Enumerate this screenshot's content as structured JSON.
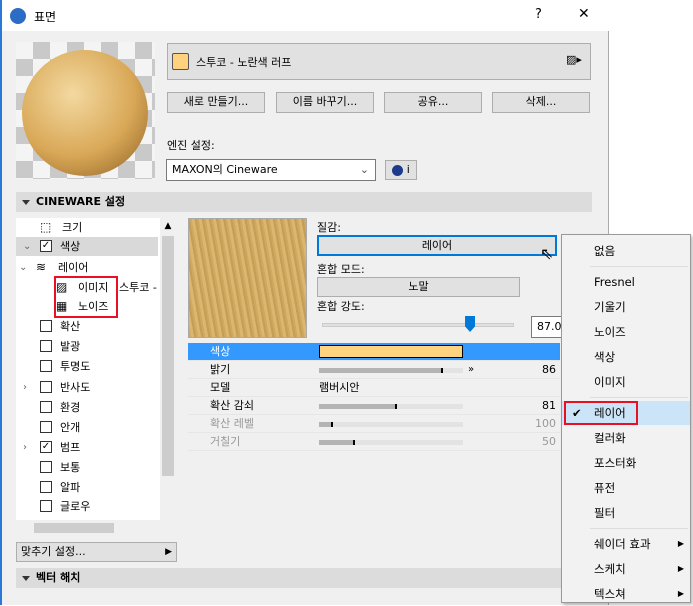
{
  "window": {
    "title": "표면",
    "help": "?",
    "close": "✕"
  },
  "material": {
    "name": "스투코 - 노란색 러프",
    "swatch_color": "#ffd27f"
  },
  "buttons": {
    "new": "새로 만들기...",
    "rename": "이름 바꾸기...",
    "share": "공유...",
    "delete": "삭제..."
  },
  "engine": {
    "label": "엔진 설정:",
    "value": "MAXON의 Cineware",
    "info": "i"
  },
  "sections": {
    "cineware": "CINEWARE 설정",
    "vector_hatch": "벡터 해치"
  },
  "tree": [
    {
      "label": "크기",
      "level": 0,
      "icon": "size-icon"
    },
    {
      "label": "색상",
      "level": 0,
      "checkbox": true,
      "checked": true,
      "expanded": true,
      "selected": true
    },
    {
      "label": "레이어",
      "level": 1,
      "icon": "layers-icon",
      "expanded": true
    },
    {
      "label": "이미지",
      "level": 2,
      "icon": "image-icon",
      "suffix": "스투코 -"
    },
    {
      "label": "노이즈",
      "level": 2,
      "icon": "noise-icon"
    },
    {
      "label": "확산",
      "level": 0,
      "checkbox": true
    },
    {
      "label": "발광",
      "level": 0,
      "checkbox": true
    },
    {
      "label": "투명도",
      "level": 0,
      "checkbox": true
    },
    {
      "label": "반사도",
      "level": 0,
      "checkbox": true,
      "collapsed": true
    },
    {
      "label": "환경",
      "level": 0,
      "checkbox": true
    },
    {
      "label": "안개",
      "level": 0,
      "checkbox": true
    },
    {
      "label": "범프",
      "level": 0,
      "checkbox": true,
      "checked": true,
      "collapsed": true
    },
    {
      "label": "보통",
      "level": 0,
      "checkbox": true
    },
    {
      "label": "알파",
      "level": 0,
      "checkbox": true
    },
    {
      "label": "글로우",
      "level": 0,
      "checkbox": true
    }
  ],
  "fit_settings": "맞추기 설정...",
  "props": {
    "texture_label": "질감:",
    "texture_value": "레이어",
    "blend_mode_label": "혼합 모드:",
    "blend_mode_value": "노말",
    "blend_strength_label": "혼합 강도:",
    "blend_strength_value": "87.00",
    "blend_strength_fraction": 0.87
  },
  "table": [
    {
      "label": "색상",
      "selected": true,
      "color": "#ffd27f"
    },
    {
      "label": "밝기",
      "value": "86",
      "fraction": 0.86,
      "arrow": true
    },
    {
      "label": "모델",
      "text": "램버시안"
    },
    {
      "label": "확산 감쇠",
      "value": "81",
      "fraction": 0.54
    },
    {
      "label": "확산 레벨",
      "value": "100",
      "fraction": 0.1,
      "disabled": true
    },
    {
      "label": "거칠기",
      "value": "50",
      "fraction": 0.25,
      "disabled": true
    }
  ],
  "menu": [
    {
      "label": "없음"
    },
    {
      "sep": true
    },
    {
      "label": "Fresnel"
    },
    {
      "label": "기울기"
    },
    {
      "label": "노이즈"
    },
    {
      "label": "색상"
    },
    {
      "label": "이미지"
    },
    {
      "sep": true
    },
    {
      "label": "레이어",
      "checked": true
    },
    {
      "label": "컬러화"
    },
    {
      "label": "포스터화"
    },
    {
      "label": "퓨전"
    },
    {
      "label": "필터"
    },
    {
      "sep": true
    },
    {
      "label": "쉐이더 효과",
      "submenu": true
    },
    {
      "label": "스케치",
      "submenu": true
    },
    {
      "label": "텍스쳐",
      "submenu": true
    }
  ],
  "accent": "#3399ff",
  "highlight_box": "#e81123"
}
